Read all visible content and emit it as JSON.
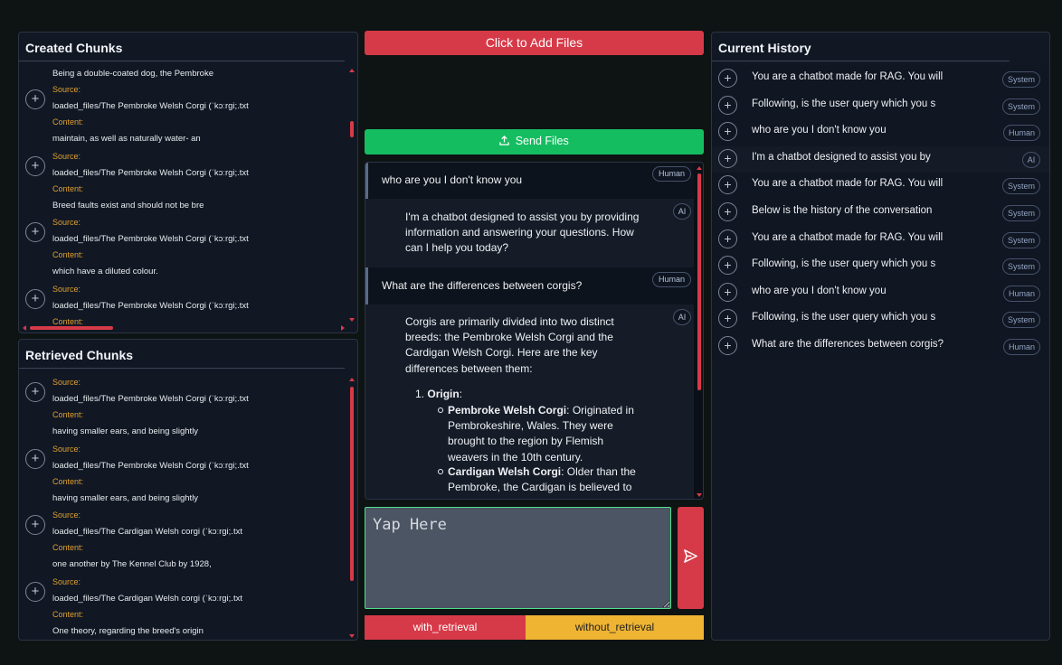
{
  "created_chunks": {
    "title": "Created Chunks",
    "first_line": "Being a double-coated dog, the Pembroke",
    "items": [
      {
        "source_label": "Source:",
        "source": "loaded_files/The Pembroke Welsh Corgi (ˈkɔːrɡi;.txt",
        "content_label": "Content:",
        "content": "maintain, as well as naturally water- an"
      },
      {
        "source_label": "Source:",
        "source": "loaded_files/The Pembroke Welsh Corgi (ˈkɔːrɡi;.txt",
        "content_label": "Content:",
        "content": "Breed faults exist and should not be bre"
      },
      {
        "source_label": "Source:",
        "source": "loaded_files/The Pembroke Welsh Corgi (ˈkɔːrɡi;.txt",
        "content_label": "Content:",
        "content": "which have a diluted colour."
      },
      {
        "source_label": "Source:",
        "source": "loaded_files/The Pembroke Welsh Corgi (ˈkɔːrɡi;.txt",
        "content_label": "Content:",
        "content": ""
      }
    ]
  },
  "retrieved_chunks": {
    "title": "Retrieved Chunks",
    "items": [
      {
        "source_label": "Source:",
        "source": "loaded_files/The Pembroke Welsh Corgi (ˈkɔːrɡi;.txt",
        "content_label": "Content:",
        "content": "having smaller ears, and being slightly"
      },
      {
        "source_label": "Source:",
        "source": "loaded_files/The Pembroke Welsh Corgi (ˈkɔːrɡi;.txt",
        "content_label": "Content:",
        "content": "having smaller ears, and being slightly"
      },
      {
        "source_label": "Source:",
        "source": "loaded_files/The Cardigan Welsh corgi (ˈkɔːrɡi;.txt",
        "content_label": "Content:",
        "content": "one another by The Kennel Club by 1928,"
      },
      {
        "source_label": "Source:",
        "source": "loaded_files/The Cardigan Welsh corgi (ˈkɔːrɡi;.txt",
        "content_label": "Content:",
        "content": "One theory, regarding the breed's origin"
      }
    ]
  },
  "buttons": {
    "add_files": "Click to Add Files",
    "send_files": "Send Files",
    "with_retrieval": "with_retrieval",
    "without_retrieval": "without_retrieval"
  },
  "chat": {
    "messages": [
      {
        "role": "Human",
        "lines": [
          "who are you I don't know you"
        ]
      },
      {
        "role": "AI",
        "lines": [
          "I'm a chatbot designed to assist you by providing",
          "information and answering your questions. How",
          "can I help you today?"
        ]
      },
      {
        "role": "Human",
        "lines": [
          "What are the differences between corgis?"
        ]
      },
      {
        "role": "AI",
        "lines": [
          "Corgis are primarily divided into two distinct",
          "breeds: the Pembroke Welsh Corgi and the",
          "Cardigan Welsh Corgi. Here are the key",
          "differences between them:"
        ]
      }
    ],
    "list": {
      "number": "1.",
      "heading": "Origin",
      "colon": ":",
      "bullets": [
        {
          "bold": "Pembroke Welsh Corgi",
          "lines": [
            ": Originated in",
            "Pembrokeshire, Wales. They were",
            "brought to the region by Flemish",
            "weavers in the 10th century."
          ]
        },
        {
          "bold": "Cardigan Welsh Corgi",
          "lines": [
            ": Older than the",
            "Pembroke, the Cardigan is believed to"
          ]
        }
      ]
    },
    "input_placeholder": "Yap Here"
  },
  "history": {
    "title": "Current History",
    "rows": [
      {
        "text": "You are a chatbot made for RAG. You will",
        "role": "System"
      },
      {
        "text": "Following, is the user query which you s",
        "role": "System"
      },
      {
        "text": "who are you I don't know you",
        "role": "Human"
      },
      {
        "text": "I'm a chatbot designed to assist you by",
        "role": "AI"
      },
      {
        "text": "You are a chatbot made for RAG. You will",
        "role": "System"
      },
      {
        "text": "Below is the history of the conversation",
        "role": "System"
      },
      {
        "text": "You are a chatbot made for RAG. You will",
        "role": "System"
      },
      {
        "text": "Following, is the user query which you s",
        "role": "System"
      },
      {
        "text": "who are you I don't know you",
        "role": "Human"
      },
      {
        "text": "Following, is the user query which you s",
        "role": "System"
      },
      {
        "text": "What are the differences between corgis?",
        "role": "Human"
      }
    ]
  },
  "colors": {
    "accent_red": "#d63a48",
    "accent_green": "#15bd61",
    "accent_yellow": "#eeb432",
    "source_label": "#e0a030"
  }
}
